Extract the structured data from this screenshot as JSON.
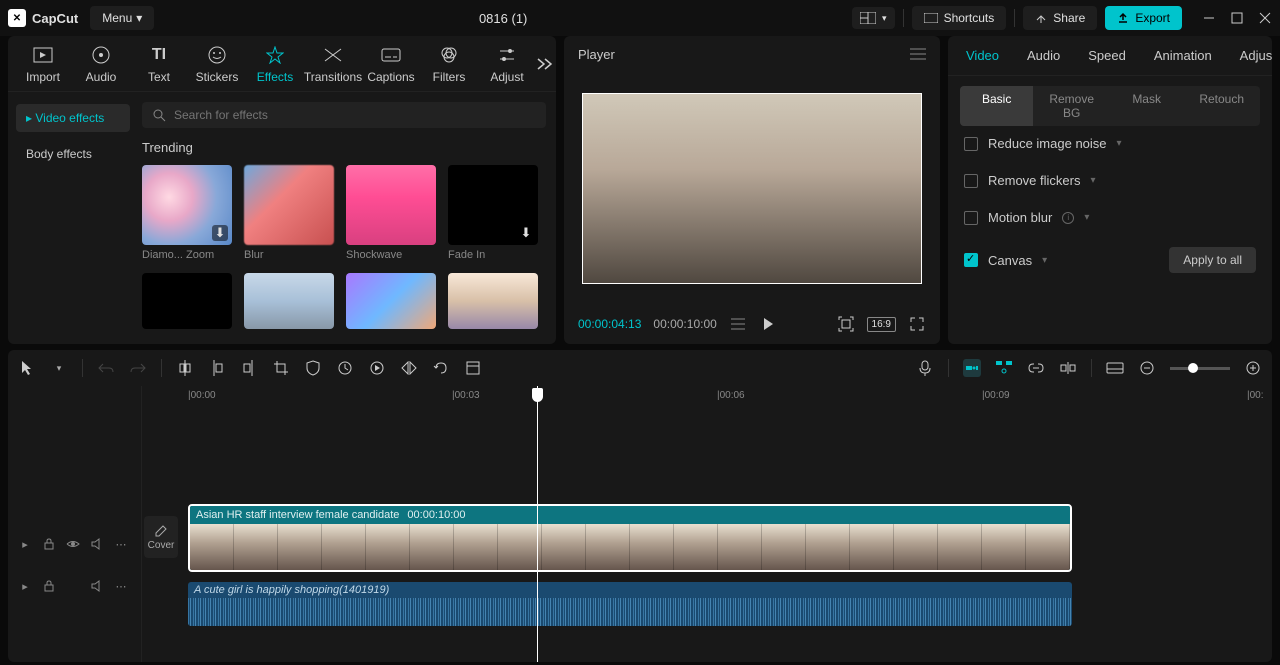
{
  "app": {
    "name": "CapCut",
    "menu": "Menu",
    "project_title": "0816 (1)"
  },
  "titlebar": {
    "layout_icon": "layout",
    "shortcuts": "Shortcuts",
    "share": "Share",
    "export": "Export"
  },
  "media_tabs": {
    "import": "Import",
    "audio": "Audio",
    "text": "Text",
    "stickers": "Stickers",
    "effects": "Effects",
    "transitions": "Transitions",
    "captions": "Captions",
    "filters": "Filters",
    "adjust": "Adjust"
  },
  "effects_panel": {
    "side": {
      "video_effects": "Video effects",
      "body_effects": "Body effects"
    },
    "search_placeholder": "Search for effects",
    "trending_title": "Trending",
    "items": {
      "diamond_zoom": "Diamo... Zoom",
      "blur": "Blur",
      "shockwave": "Shockwave",
      "fade_in": "Fade In"
    }
  },
  "player": {
    "title": "Player",
    "current_time": "00:00:04:13",
    "total_time": "00:00:10:00",
    "ratio": "16:9"
  },
  "inspector": {
    "tabs": {
      "video": "Video",
      "audio": "Audio",
      "speed": "Speed",
      "animation": "Animation",
      "adjust": "Adjust"
    },
    "subtabs": {
      "basic": "Basic",
      "remove_bg": "Remove BG",
      "mask": "Mask",
      "retouch": "Retouch"
    },
    "options": {
      "reduce_noise": "Reduce image noise",
      "remove_flickers": "Remove flickers",
      "motion_blur": "Motion blur",
      "canvas": "Canvas"
    },
    "apply_to_all": "Apply to all"
  },
  "timeline": {
    "ruler": {
      "t0": "|00:00",
      "t3": "|00:03",
      "t6": "|00:06",
      "t9": "|00:09",
      "tend": "|00:"
    },
    "cover": "Cover",
    "video_clip": {
      "title": "Asian HR staff interview female candidate",
      "duration": "00:00:10:00"
    },
    "audio_clip": {
      "title": "A cute girl is happily shopping(1401919)"
    }
  }
}
